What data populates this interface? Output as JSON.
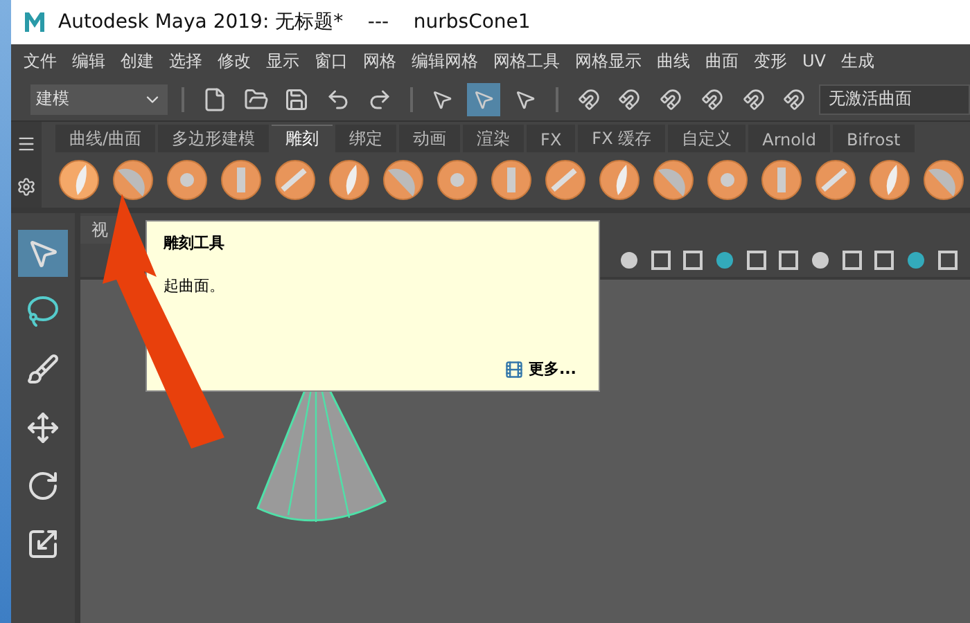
{
  "window": {
    "title": "Autodesk Maya 2019: 无标题*    ---    nurbsCone1"
  },
  "menu": [
    "文件",
    "编辑",
    "创建",
    "选择",
    "修改",
    "显示",
    "窗口",
    "网格",
    "编辑网格",
    "网格工具",
    "网格显示",
    "曲线",
    "曲面",
    "变形",
    "UV",
    "生成"
  ],
  "toolbar": {
    "mode": "建模",
    "select_modes": [
      {
        "selected": false
      },
      {
        "selected": true
      },
      {
        "selected": false
      }
    ],
    "live_surface": "无激活曲面"
  },
  "shelf": {
    "tabs": [
      {
        "label": "曲线/曲面",
        "selected": false
      },
      {
        "label": "多边形建模",
        "selected": false
      },
      {
        "label": "雕刻",
        "selected": true
      },
      {
        "label": "绑定",
        "selected": false
      },
      {
        "label": "动画",
        "selected": false
      },
      {
        "label": "渲染",
        "selected": false
      },
      {
        "label": "FX",
        "selected": false
      },
      {
        "label": "FX 缓存",
        "selected": false
      },
      {
        "label": "自定义",
        "selected": false
      },
      {
        "label": "Arnold",
        "selected": false
      },
      {
        "label": "Bifrost",
        "selected": false
      }
    ]
  },
  "tooltip": {
    "title": "雕刻工具",
    "description": "起曲面。",
    "more": "更多..."
  },
  "tools": [
    {
      "kind": "select",
      "selected": true
    },
    {
      "kind": "lasso",
      "selected": false
    },
    {
      "kind": "paint",
      "selected": false
    },
    {
      "kind": "move",
      "selected": false
    },
    {
      "kind": "rotate",
      "selected": false
    },
    {
      "kind": "scale",
      "selected": false
    }
  ],
  "viewport": {
    "tab": "视"
  }
}
